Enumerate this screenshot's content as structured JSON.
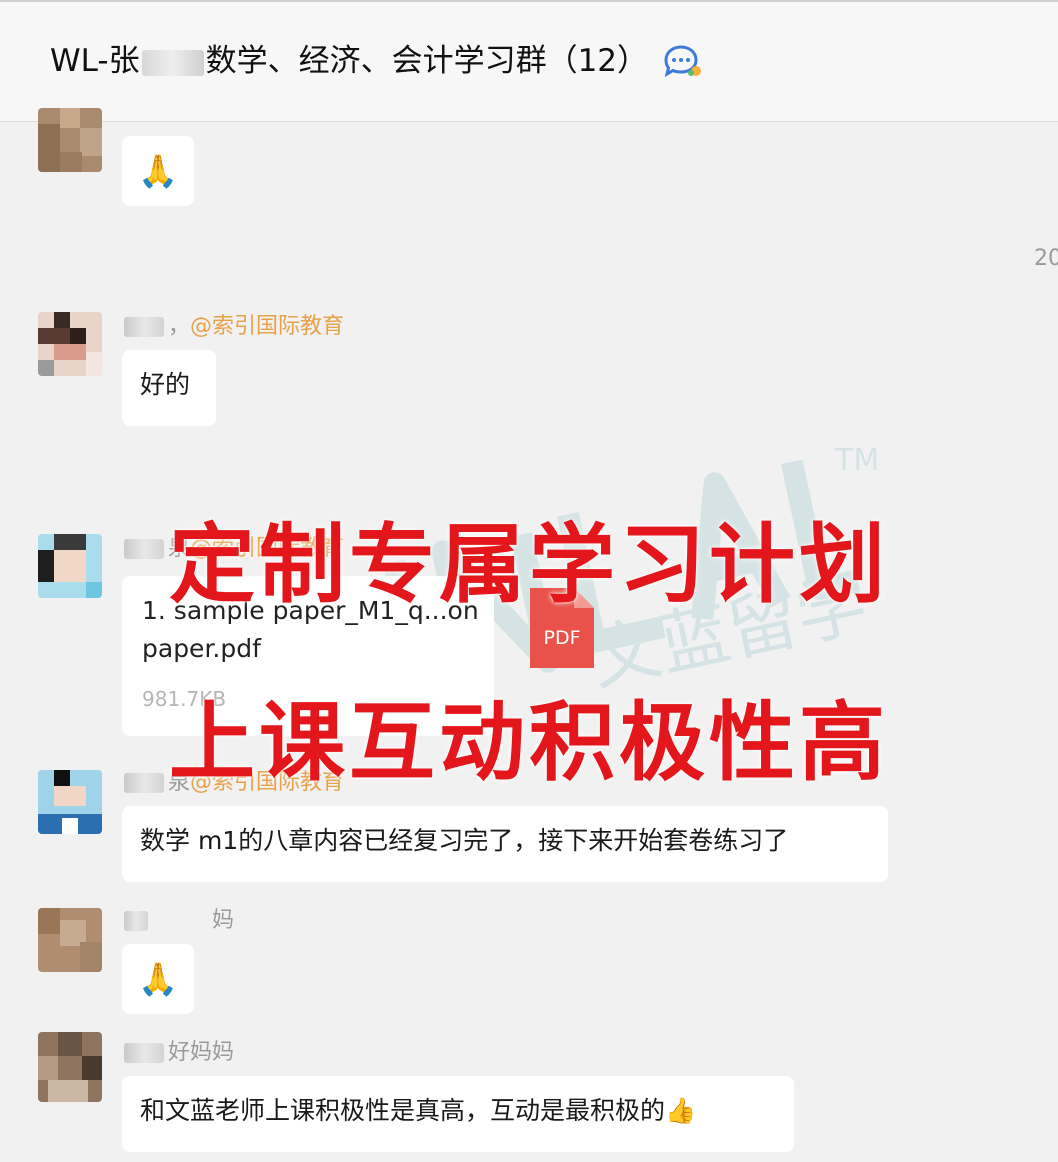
{
  "header": {
    "title_prefix": "WL-张",
    "title_suffix": "数学、经济、会计学习群（12）",
    "chat_icon": "chat-bubble-icon"
  },
  "timestamp": "20",
  "messages": [
    {
      "sender": "",
      "text": "🙏",
      "kind": "emoji"
    },
    {
      "sender_visible": "，",
      "org": "@索引国际教育",
      "text": "好的"
    },
    {
      "sender_visible": "泉",
      "org": "@索引国际教育",
      "kind": "file",
      "file": {
        "name": "1. sample paper_M1_q...on paper.pdf",
        "size": "981.7KB",
        "type_label": "PDF"
      }
    },
    {
      "sender_visible": "泉",
      "org": "@索引国际教育",
      "text": "数学 m1的八章内容已经复习完了，接下来开始套卷练习了"
    },
    {
      "sender_visible": "妈",
      "text": "🙏",
      "kind": "emoji"
    },
    {
      "sender_visible": "好妈妈",
      "text": "和文蓝老师上课积极性是真高，互动是最积极的👍"
    }
  ],
  "promo": {
    "line1": "定制专属学习计划",
    "line2": "上课互动积极性高"
  },
  "watermark": {
    "brand": "WINLAND",
    "cn": "文蓝留学",
    "tm": "TM"
  },
  "colors": {
    "promo": "#e3161b",
    "org": "#e8a24a",
    "pdf": "#e8524a",
    "bubble": "#ffffff",
    "bg": "#f1f1f1"
  }
}
